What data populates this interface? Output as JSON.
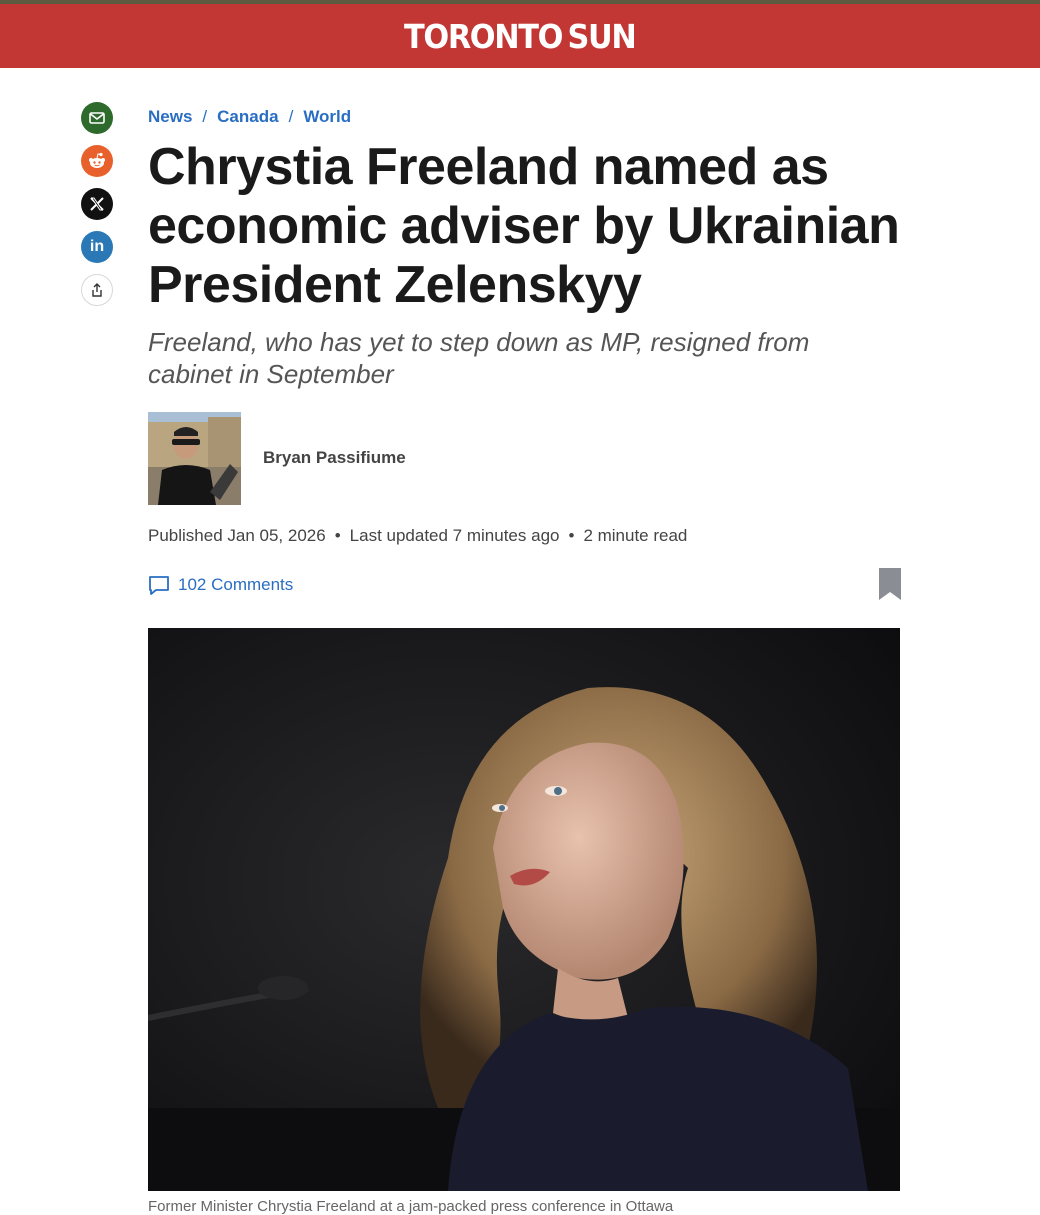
{
  "brand": {
    "name_part1": "TORONTO",
    "name_part2": "SUN",
    "header_color": "#c23633"
  },
  "share": [
    {
      "icon": "mail-icon",
      "label": "Email"
    },
    {
      "icon": "reddit-icon",
      "label": "Reddit"
    },
    {
      "icon": "x-icon",
      "label": "X"
    },
    {
      "icon": "linkedin-icon",
      "label": "in"
    },
    {
      "icon": "share-icon",
      "label": "Share"
    }
  ],
  "breadcrumb": [
    "News",
    "Canada",
    "World"
  ],
  "article": {
    "title": "Chrystia Freeland named as economic adviser by Ukrainian President Zelenskyy",
    "subtitle": "Freeland, who has yet to step down as MP, resigned from cabinet in September",
    "author": "Bryan Passifiume",
    "published": "Published Jan 05, 2026",
    "updated": "Last updated 7 minutes ago",
    "read_time": "2 minute read",
    "comments": "102 Comments",
    "caption": "Former Minister Chrystia Freeland at a jam-packed press conference in Ottawa"
  }
}
